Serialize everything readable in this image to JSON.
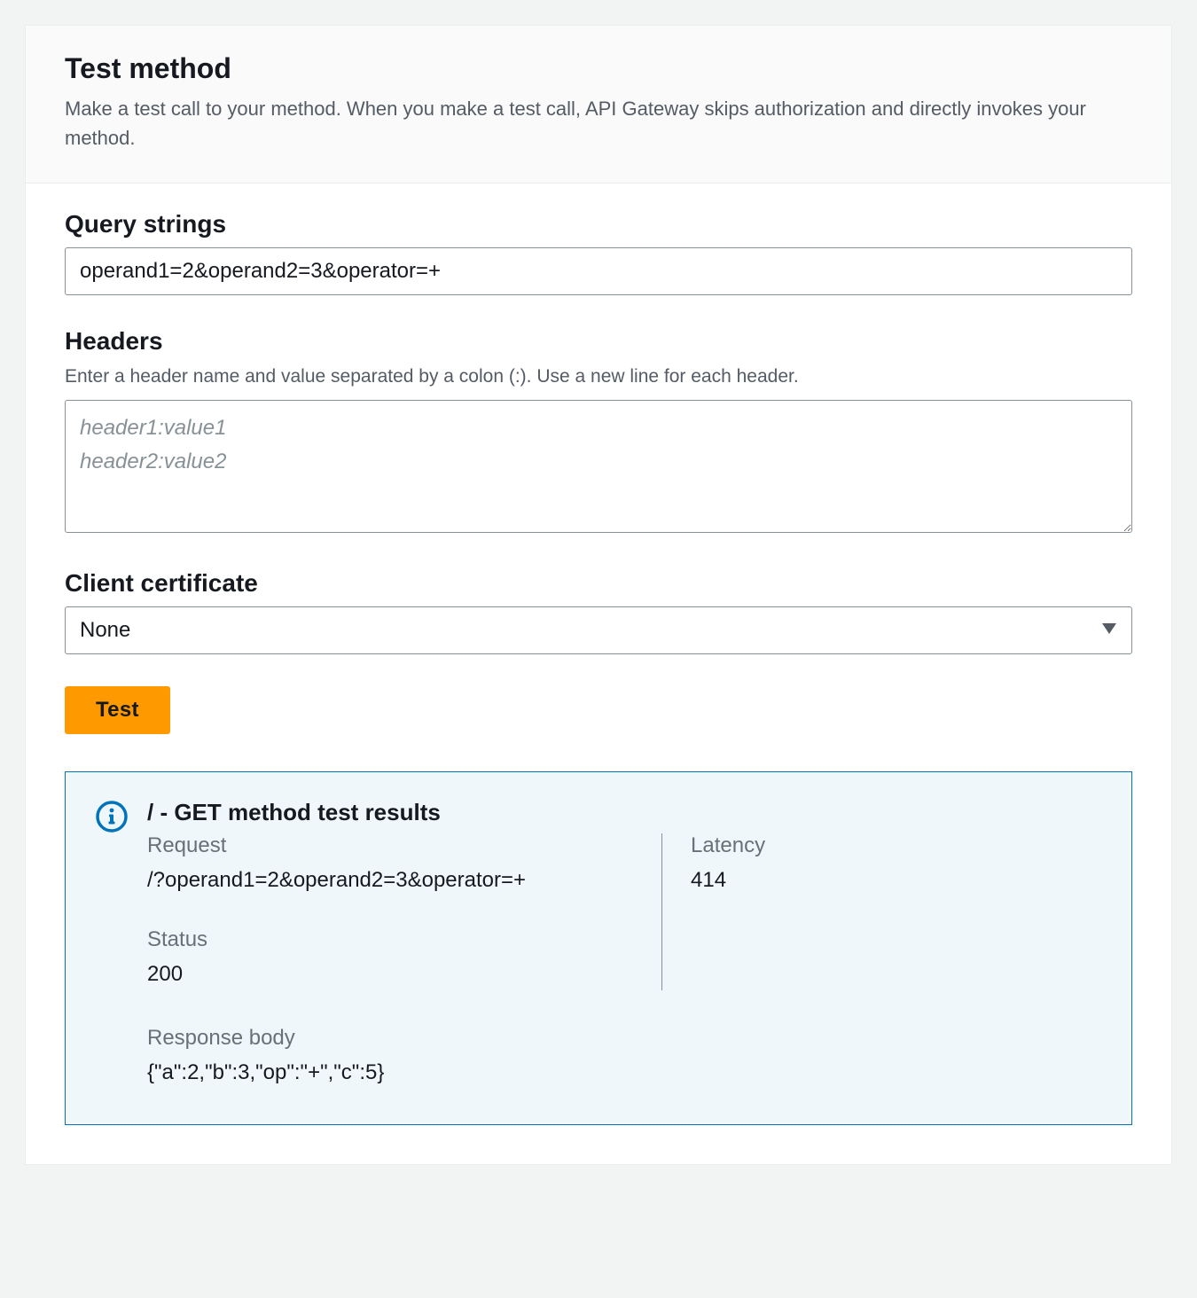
{
  "header": {
    "title": "Test method",
    "description": "Make a test call to your method. When you make a test call, API Gateway skips authorization and directly invokes your method."
  },
  "query_strings": {
    "label": "Query strings",
    "value": "operand1=2&operand2=3&operator=+"
  },
  "headers": {
    "label": "Headers",
    "help": "Enter a header name and value separated by a colon (:). Use a new line for each header.",
    "placeholder": "header1:value1\nheader2:value2",
    "value": ""
  },
  "client_certificate": {
    "label": "Client certificate",
    "selected": "None"
  },
  "test_button": {
    "label": "Test"
  },
  "results": {
    "title": "/ - GET method test results",
    "request_label": "Request",
    "request_value": "/?operand1=2&operand2=3&operator=+",
    "latency_label": "Latency",
    "latency_value": "414",
    "status_label": "Status",
    "status_value": "200",
    "body_label": "Response body",
    "body_value": "{\"a\":2,\"b\":3,\"op\":\"+\",\"c\":5}"
  }
}
